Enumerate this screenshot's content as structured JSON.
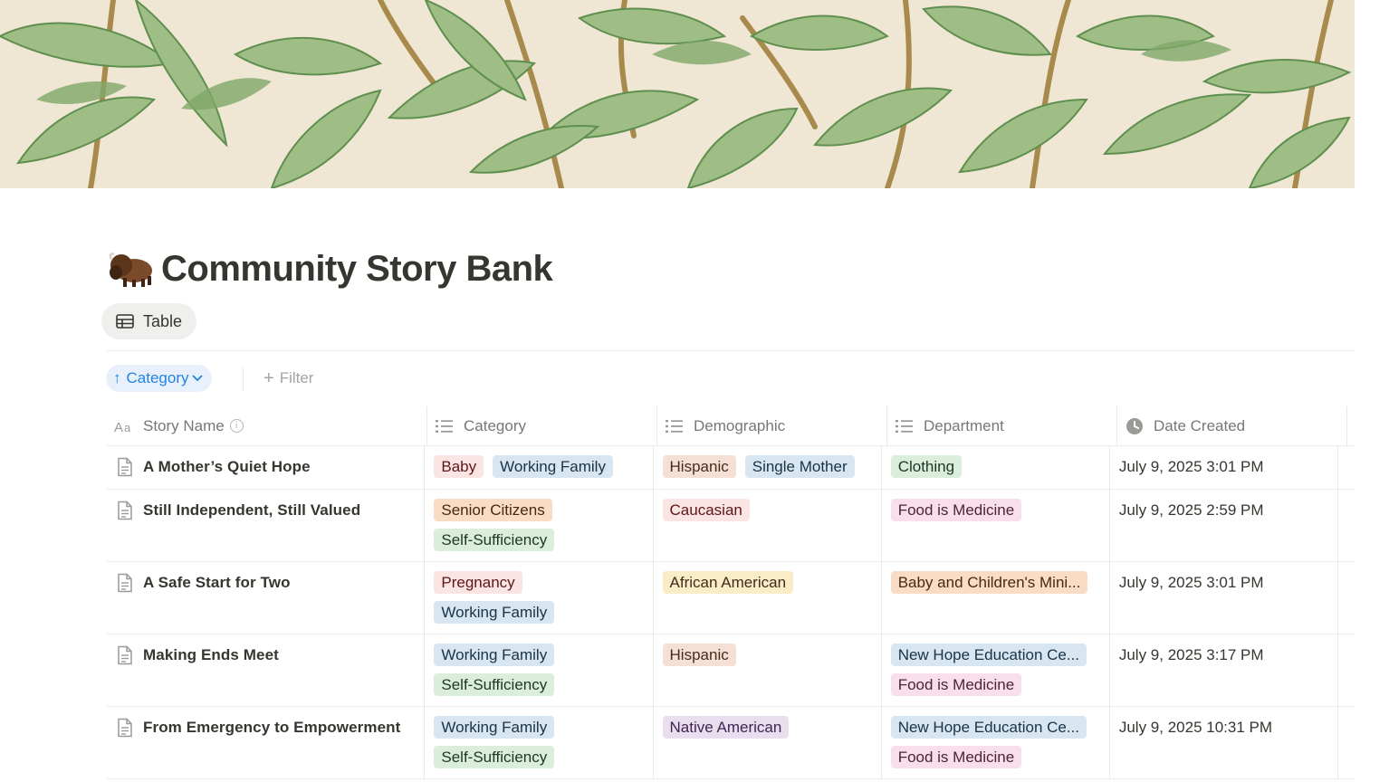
{
  "page": {
    "title": "Community Story Bank",
    "icon": "bison-emoji"
  },
  "view": {
    "tab_label": "Table",
    "tab_icon": "table-icon"
  },
  "toolbar": {
    "sort_label": "Category",
    "sort_direction": "ascending",
    "filter_label": "Filter"
  },
  "columns": [
    {
      "label": "Story Name",
      "icon": "text-property-icon"
    },
    {
      "label": "Category",
      "icon": "list-property-icon"
    },
    {
      "label": "Demographic",
      "icon": "list-property-icon"
    },
    {
      "label": "Department",
      "icon": "list-property-icon"
    },
    {
      "label": "Date Created",
      "icon": "clock-icon"
    }
  ],
  "rows": [
    {
      "name": "A Mother’s Quiet Hope",
      "category": [
        {
          "label": "Baby",
          "color": "red"
        },
        {
          "label": "Working Family",
          "color": "blue"
        }
      ],
      "demographic": [
        {
          "label": "Hispanic",
          "color": "brown"
        },
        {
          "label": "Single Mother",
          "color": "blue"
        }
      ],
      "department": [
        {
          "label": "Clothing",
          "color": "green"
        }
      ],
      "date": "July 9, 2025 3:01 PM"
    },
    {
      "name": "Still Independent, Still Valued",
      "category": [
        {
          "label": "Senior Citizens",
          "color": "orange"
        },
        {
          "label": "Self-Sufficiency",
          "color": "green"
        }
      ],
      "demographic": [
        {
          "label": "Caucasian",
          "color": "red"
        }
      ],
      "department": [
        {
          "label": "Food is Medicine",
          "color": "pink"
        }
      ],
      "date": "July 9, 2025 2:59 PM"
    },
    {
      "name": "A Safe Start for Two",
      "category": [
        {
          "label": "Pregnancy",
          "color": "red"
        },
        {
          "label": "Working Family",
          "color": "blue"
        }
      ],
      "demographic": [
        {
          "label": "African American",
          "color": "yellow"
        }
      ],
      "department": [
        {
          "label": "Baby and Children's Mini...",
          "color": "orange"
        }
      ],
      "date": "July 9, 2025 3:01 PM"
    },
    {
      "name": "Making Ends Meet",
      "category": [
        {
          "label": "Working Family",
          "color": "blue"
        },
        {
          "label": "Self-Sufficiency",
          "color": "green"
        }
      ],
      "demographic": [
        {
          "label": "Hispanic",
          "color": "brown"
        }
      ],
      "department": [
        {
          "label": "New Hope Education Ce...",
          "color": "blue"
        },
        {
          "label": "Food is Medicine",
          "color": "pink"
        }
      ],
      "date": "July 9, 2025 3:17 PM"
    },
    {
      "name": "From Emergency to Empowerment",
      "category": [
        {
          "label": "Working Family",
          "color": "blue"
        },
        {
          "label": "Self-Sufficiency",
          "color": "green"
        }
      ],
      "demographic": [
        {
          "label": "Native American",
          "color": "purple"
        }
      ],
      "department": [
        {
          "label": "New Hope Education Ce...",
          "color": "blue"
        },
        {
          "label": "Food is Medicine",
          "color": "pink"
        }
      ],
      "date": "July 9, 2025 10:31 PM"
    }
  ],
  "colors": {
    "accent": "#2383e2",
    "text": "#37352f",
    "muted": "#787774",
    "border": "#e9e9e7"
  }
}
